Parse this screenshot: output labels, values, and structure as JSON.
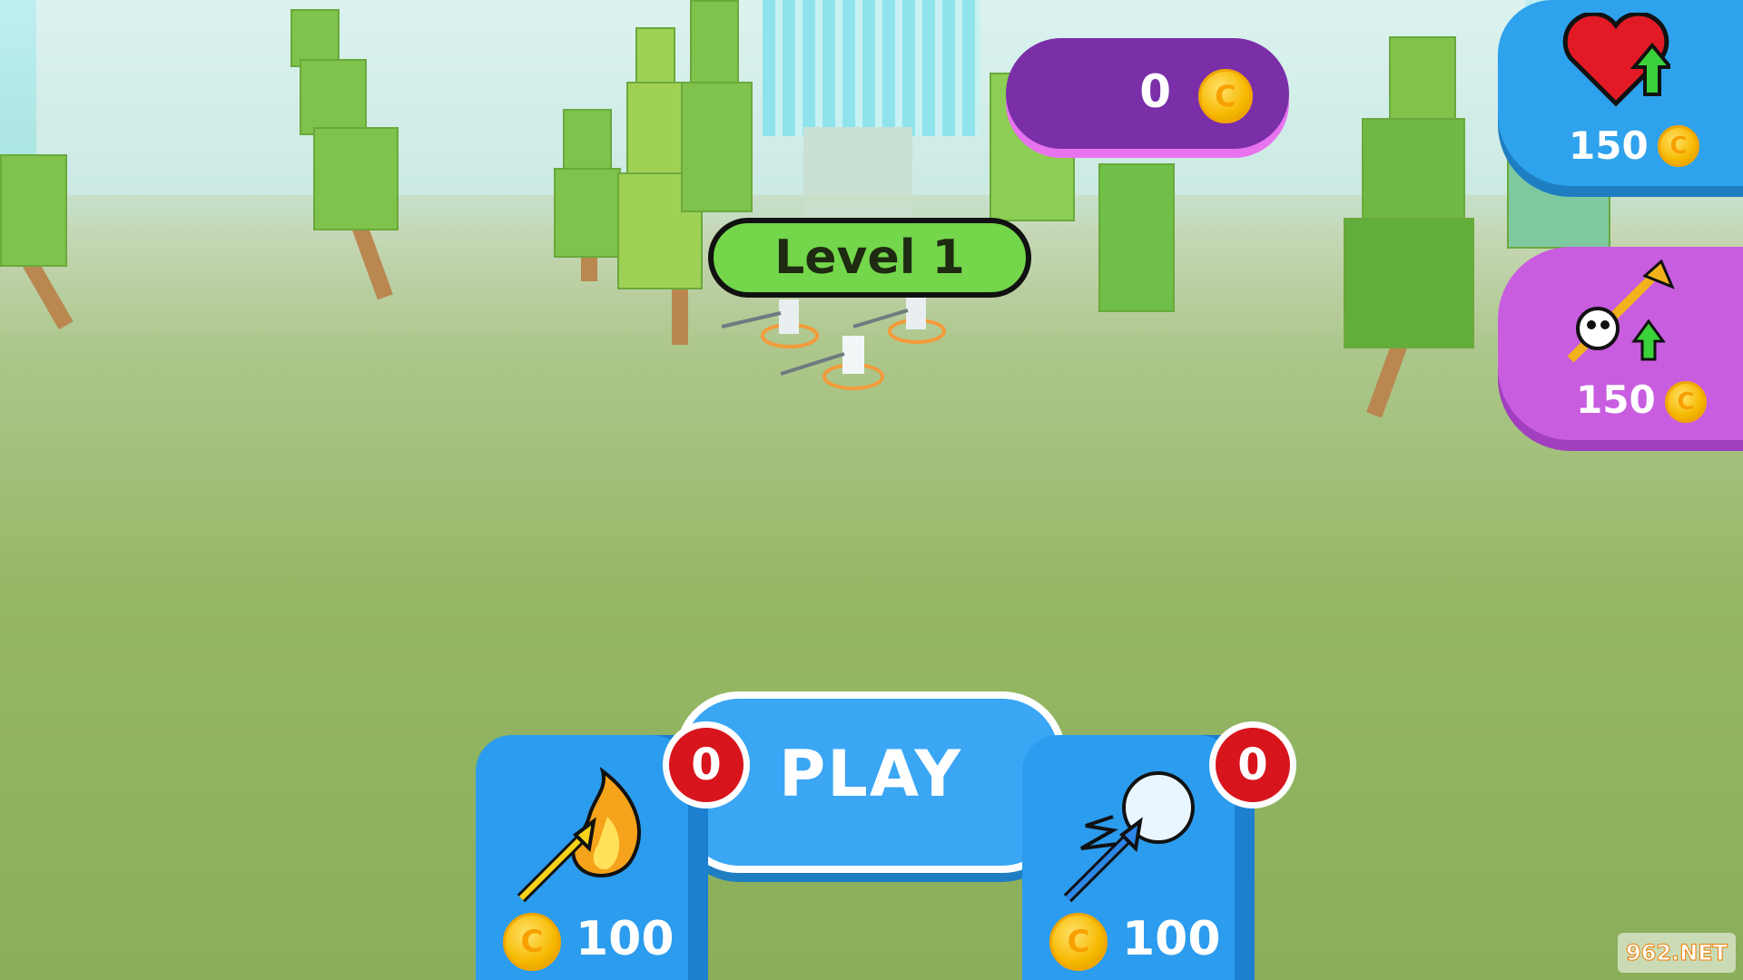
{
  "hud": {
    "coins": {
      "value": "0"
    },
    "coin_symbol": "C",
    "level_label": "Level 1"
  },
  "upgrades": {
    "health": {
      "icon": "heart-upgrade-icon",
      "price": "150"
    },
    "attack": {
      "icon": "arrow-skull-upgrade-icon",
      "price": "150"
    }
  },
  "play_button": {
    "label": "PLAY"
  },
  "skills": {
    "fire_arrow": {
      "icon": "fire-arrow-icon",
      "count": "0",
      "cost": "100"
    },
    "ice_arrow": {
      "icon": "ice-arrow-icon",
      "count": "0",
      "cost": "100"
    }
  },
  "watermark": {
    "text": "962.NET"
  },
  "colors": {
    "coin_counter_bg": "#7a2fa8",
    "level_badge_bg": "#74d64a",
    "health_panel_bg": "#2ea2ec",
    "attack_panel_bg": "#c85de0",
    "play_button_bg": "#3aa6f4",
    "count_badge_bg": "#d8141c"
  }
}
